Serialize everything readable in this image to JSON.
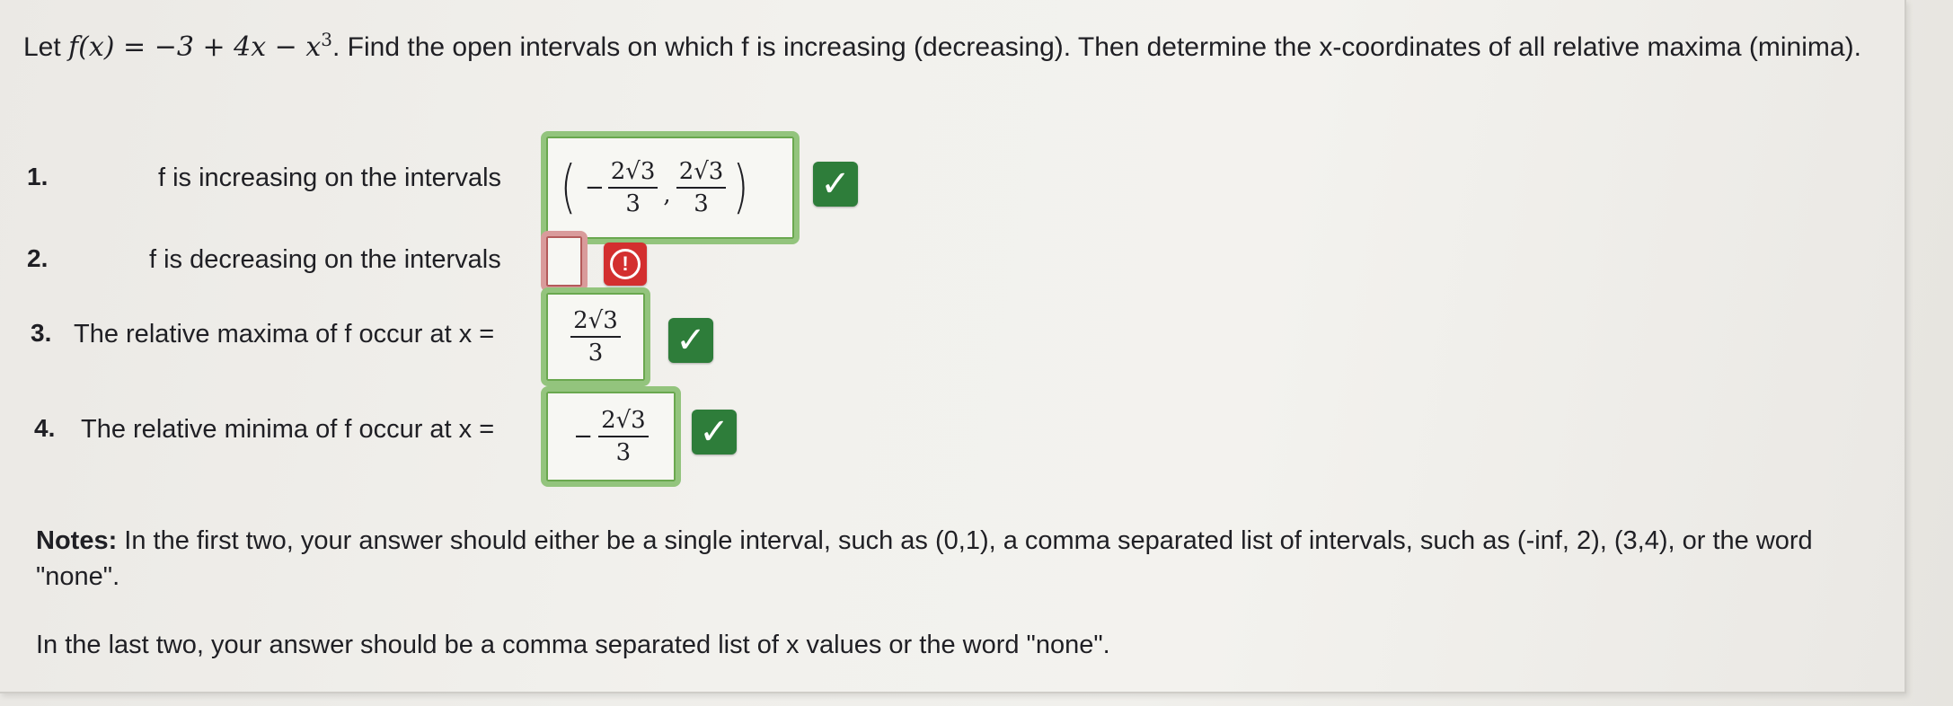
{
  "prompt": {
    "let": "Let",
    "function_def": "f(x) = −3 + 4x − x",
    "exp": "3",
    "text": ". Find the open intervals on which f is increasing (decreasing). Then determine the x-coordinates of all relative maxima (minima)."
  },
  "questions": [
    {
      "number": "1.",
      "label": "f is increasing on the intervals",
      "answer_display": [
        "−",
        "2√3",
        "3",
        "2√3",
        "3"
      ],
      "status": "correct"
    },
    {
      "number": "2.",
      "label": "f is decreasing on the intervals",
      "answer_value": "",
      "status": "incorrect"
    },
    {
      "number": "3.",
      "label": "The relative maxima of f occur at x =",
      "answer_display": [
        "",
        "2√3",
        "3"
      ],
      "status": "correct"
    },
    {
      "number": "4.",
      "label": "The relative minima of f occur at x =",
      "answer_display": [
        "−",
        "2√3",
        "3"
      ],
      "status": "correct"
    }
  ],
  "notes": {
    "bold": "Notes:",
    "line1": " In the first two, your answer should either be a single interval, such as (0,1), a comma separated list of intervals, such as (-inf, 2), (3,4), or the word \"none\".",
    "line2": "In the last two, your answer should be a comma separated list of x values or the word \"none\"."
  },
  "icons": {
    "correct": "check-icon",
    "incorrect": "exclamation-circle-icon"
  },
  "colors": {
    "correct_badge": "#2e7d3a",
    "incorrect_badge": "#d32f2f",
    "correct_border": "#93c47d",
    "incorrect_border": "#d99b9b"
  }
}
